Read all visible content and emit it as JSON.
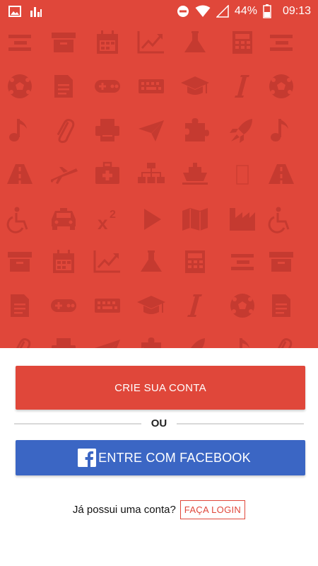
{
  "status_bar": {
    "icons_left": [
      "image-icon",
      "signal-bars-icon"
    ],
    "icons_right": [
      "do-not-disturb-icon",
      "wifi-icon",
      "cell-signal-icon",
      "battery-icon"
    ],
    "battery": "44%",
    "time": "09:13"
  },
  "hero": {
    "background_color": "#e0473a",
    "pattern_color": "#c53a30",
    "pattern_icons": [
      [
        "equalizer-icon",
        "archive-box-icon",
        "calendar-icon",
        "trending-chart-icon",
        "flask-icon",
        "calculator-icon",
        "equalizer-icon"
      ],
      [
        "soccer-ball-icon",
        "document-icon",
        "gamepad-icon",
        "keyboard-icon",
        "graduation-cap-icon",
        "italic-icon",
        "soccer-ball-icon"
      ],
      [
        "music-note-icon",
        "paperclip-icon",
        "printer-icon",
        "paper-plane-icon",
        "puzzle-piece-icon",
        "rocket-icon",
        "music-note-icon"
      ],
      [
        "road-icon",
        "airplane-icon",
        "medical-kit-icon",
        "sitemap-icon",
        "ship-icon",
        "box-outline-icon",
        "road-icon"
      ],
      [
        "wheelchair-icon",
        "taxi-icon",
        "superscript-icon",
        "play-icon",
        "map-icon",
        "factory-icon",
        "wheelchair-icon"
      ],
      [
        "archive-box-icon",
        "calendar-icon",
        "trending-chart-icon",
        "flask-icon",
        "calculator-icon",
        "equalizer-icon",
        "archive-box-icon"
      ],
      [
        "document-icon",
        "gamepad-icon",
        "keyboard-icon",
        "graduation-cap-icon",
        "italic-icon",
        "soccer-ball-icon",
        "document-icon"
      ]
    ],
    "superscript_text": "x²"
  },
  "actions": {
    "create_account_label": "CRIE SUA CONTA",
    "create_account_color": "#e0473a",
    "divider_text": "OU",
    "facebook_label": "ENTRE COM FACEBOOK",
    "facebook_color": "#3b66c4",
    "facebook_icon": "facebook-logo-icon"
  },
  "login": {
    "question": "Já possui uma conta?",
    "link_label": "FAÇA LOGIN"
  }
}
